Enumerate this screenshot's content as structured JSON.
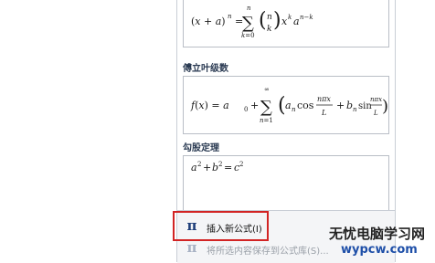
{
  "gallery": {
    "binomial": {
      "formula": "(x + a)ⁿ = ∑ₖ₌₀ⁿ (n k) xᵏ aⁿ⁻ᵏ"
    },
    "fourier": {
      "title": "傅立叶级数",
      "formula": "f(x) = a₀ + ∑ₙ₌₁^∞ (aₙ cos(nπx/L) + bₙ sin(nπx/L))"
    },
    "pythagorean": {
      "title": "勾股定理",
      "formula": "a² + b² = c²"
    }
  },
  "menu": {
    "items": [
      {
        "icon": "π",
        "label": "插入新公式(I)"
      },
      {
        "icon": "π",
        "label": "将所选内容保存到公式库(S)..."
      }
    ]
  },
  "watermark": {
    "line1": "无忧电脑学习网",
    "line2": "wypcw.com"
  },
  "colors": {
    "highlight": "#d22424",
    "heading": "#2a3a52",
    "watermark_url": "#1e4fa8"
  }
}
